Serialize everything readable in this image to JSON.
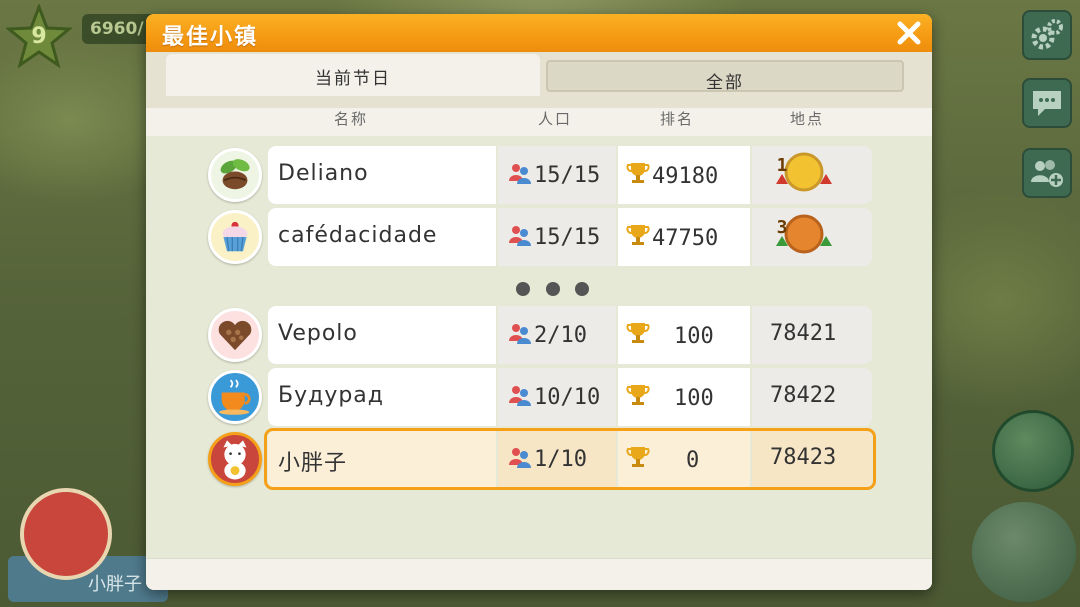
{
  "hud": {
    "level": "9",
    "coins": "6960/"
  },
  "dialog": {
    "title": "最佳小镇",
    "tabs": [
      {
        "label": "当前节日",
        "active": true
      },
      {
        "label": "全部",
        "active": false
      }
    ],
    "columns": {
      "name": "名称",
      "population": "人口",
      "rank": "排名",
      "location": "地点"
    },
    "top_rows": [
      {
        "name": "Deliano",
        "icon": "coffee-bean-icon",
        "population": "15/15",
        "score": "49180",
        "medal": "1",
        "medal_color": "#f2c230"
      },
      {
        "name": "cafédacidade",
        "icon": "cupcake-icon",
        "population": "15/15",
        "score": "47750",
        "medal": "3",
        "medal_color": "#e5852e"
      }
    ],
    "near_rows": [
      {
        "name": "Vepolo",
        "icon": "coffee-heart-icon",
        "population": "2/10",
        "score": "100",
        "place": "78421"
      },
      {
        "name": "Будурад",
        "icon": "coffee-cup-icon",
        "population": "10/10",
        "score": "100",
        "place": "78422"
      },
      {
        "name": "小胖子",
        "icon": "lucky-cat-icon",
        "population": "1/10",
        "score": "0",
        "place": "78423",
        "highlight": true
      }
    ]
  },
  "player": {
    "name": "小胖子"
  },
  "colors": {
    "accent": "#f59a13",
    "highlight_border": "#f5a019"
  }
}
